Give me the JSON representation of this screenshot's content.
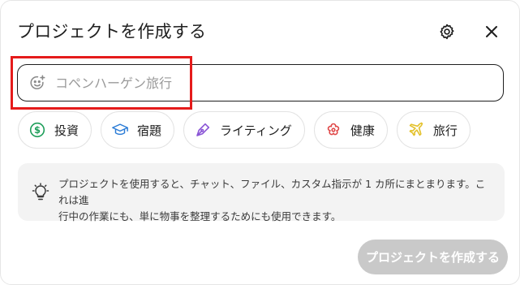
{
  "dialog": {
    "title": "プロジェクトを作成する",
    "settings_icon": "gear-icon",
    "close_icon": "close-icon"
  },
  "name_input": {
    "value": "",
    "placeholder": "コペンハーゲン旅行",
    "icon": "emoji-add-icon"
  },
  "chips": [
    {
      "label": "投資",
      "icon": "dollar-circle-icon",
      "color": "#1e9e5a"
    },
    {
      "label": "宿題",
      "icon": "graduation-cap-icon",
      "color": "#2a7bd6"
    },
    {
      "label": "ライティング",
      "icon": "pen-nib-icon",
      "color": "#8a55d6"
    },
    {
      "label": "健康",
      "icon": "flower-icon",
      "color": "#e04848"
    },
    {
      "label": "旅行",
      "icon": "airplane-icon",
      "color": "#e3c12b"
    }
  ],
  "info": {
    "icon": "lightbulb-icon",
    "line1": "プロジェクトを使用すると、チャット、ファイル、カスタム指示が 1 カ所にまとまります。これは進",
    "line2": "行中の作業にも、単に物事を整理するためにも使用できます。"
  },
  "create_button": {
    "label": "プロジェクトを作成する",
    "enabled": false
  },
  "colors": {
    "highlight": "#e51b1b",
    "disabled_button": "#c9c9c9"
  }
}
